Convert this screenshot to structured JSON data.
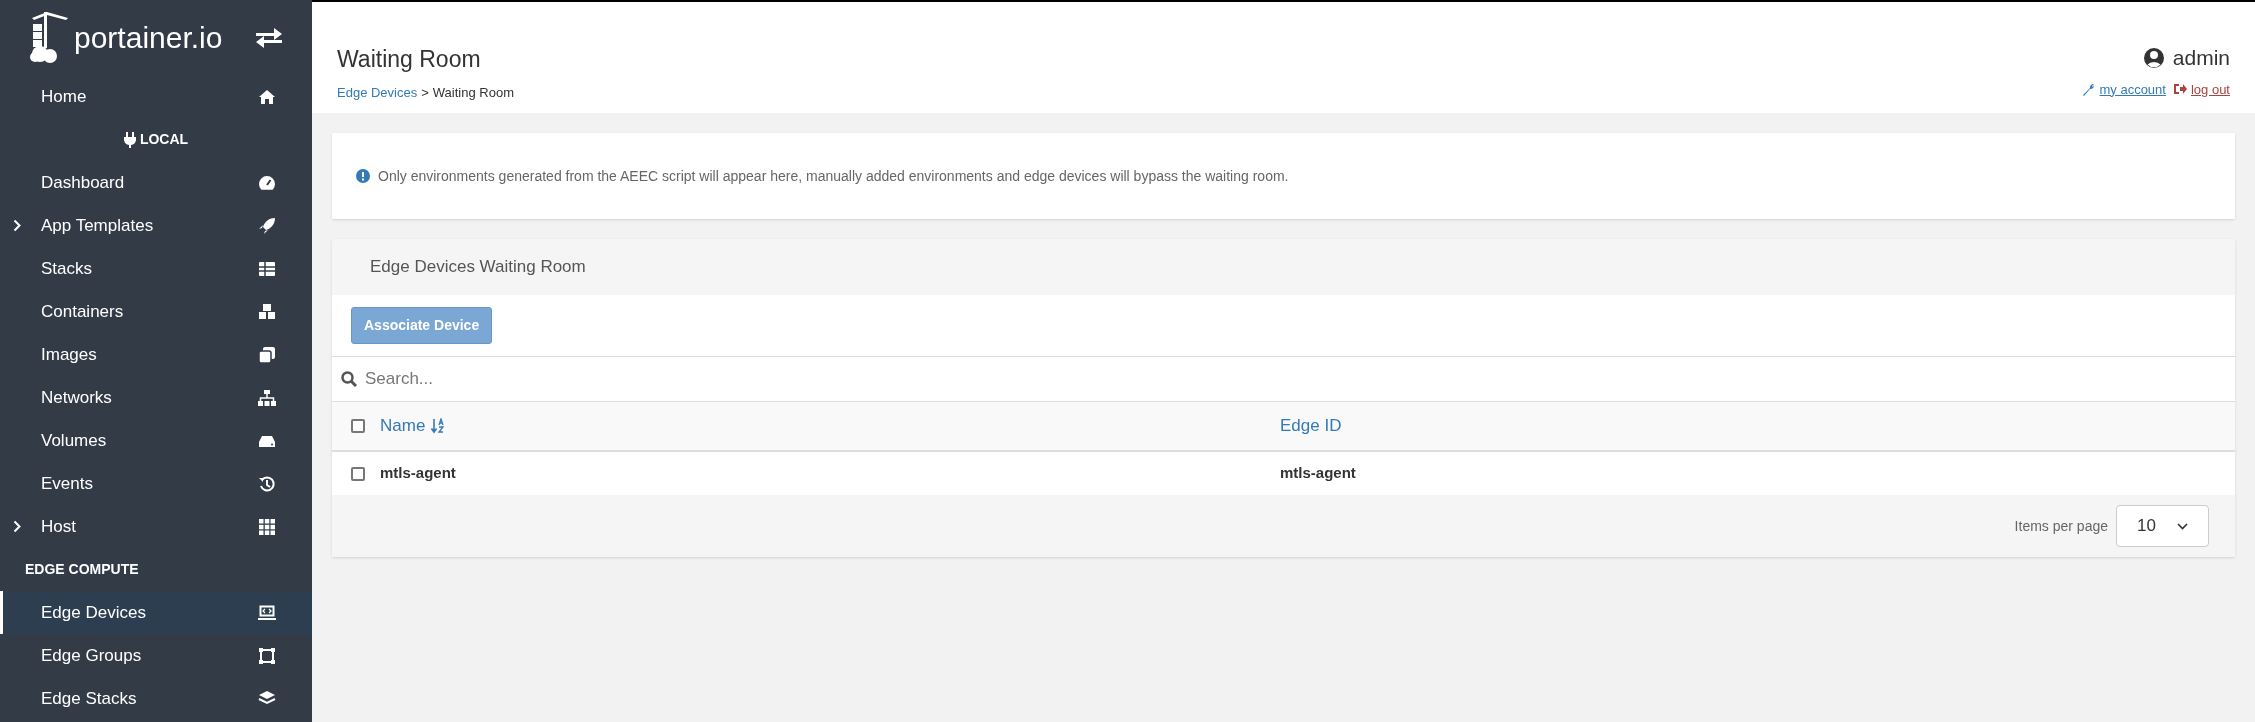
{
  "sidebar": {
    "logo": "portainer.io",
    "items": [
      {
        "kind": "item",
        "label": "Home",
        "expandable": false,
        "selected": false
      },
      {
        "kind": "endpoint",
        "label": "LOCAL"
      },
      {
        "kind": "item",
        "label": "Dashboard",
        "expandable": false,
        "selected": false
      },
      {
        "kind": "item",
        "label": "App Templates",
        "expandable": true,
        "selected": false
      },
      {
        "kind": "item",
        "label": "Stacks",
        "expandable": false,
        "selected": false
      },
      {
        "kind": "item",
        "label": "Containers",
        "expandable": false,
        "selected": false
      },
      {
        "kind": "item",
        "label": "Images",
        "expandable": false,
        "selected": false
      },
      {
        "kind": "item",
        "label": "Networks",
        "expandable": false,
        "selected": false
      },
      {
        "kind": "item",
        "label": "Volumes",
        "expandable": false,
        "selected": false
      },
      {
        "kind": "item",
        "label": "Events",
        "expandable": false,
        "selected": false
      },
      {
        "kind": "item",
        "label": "Host",
        "expandable": true,
        "selected": false
      },
      {
        "kind": "section",
        "label": "EDGE COMPUTE"
      },
      {
        "kind": "item",
        "label": "Edge Devices",
        "expandable": false,
        "selected": true
      },
      {
        "kind": "item",
        "label": "Edge Groups",
        "expandable": false,
        "selected": false
      },
      {
        "kind": "item",
        "label": "Edge Stacks",
        "expandable": false,
        "selected": false
      }
    ]
  },
  "header": {
    "title": "Waiting Room",
    "breadcrumb": [
      {
        "label": "Edge Devices",
        "link": true
      },
      {
        "label": "Waiting Room",
        "link": false
      }
    ],
    "breadcrumb_separator": ">",
    "user": "admin",
    "my_account": "my account",
    "log_out": "log out"
  },
  "info": "Only environments generated from the AEEC script will appear here, manually added environments and edge devices will bypass the waiting room.",
  "card": {
    "title": "Edge Devices Waiting Room",
    "action": "Associate Device",
    "search": {
      "placeholder": "Search..."
    },
    "select_all_checked": false,
    "columns": [
      {
        "label": "Name",
        "sorted": true
      },
      {
        "label": "Edge ID",
        "sorted": false
      }
    ],
    "rows": [
      {
        "checked": false,
        "cells": [
          "mtls-agent",
          "mtls-agent"
        ]
      }
    ],
    "items_per_page_label": "Items per page",
    "items_per_page": "10"
  }
}
